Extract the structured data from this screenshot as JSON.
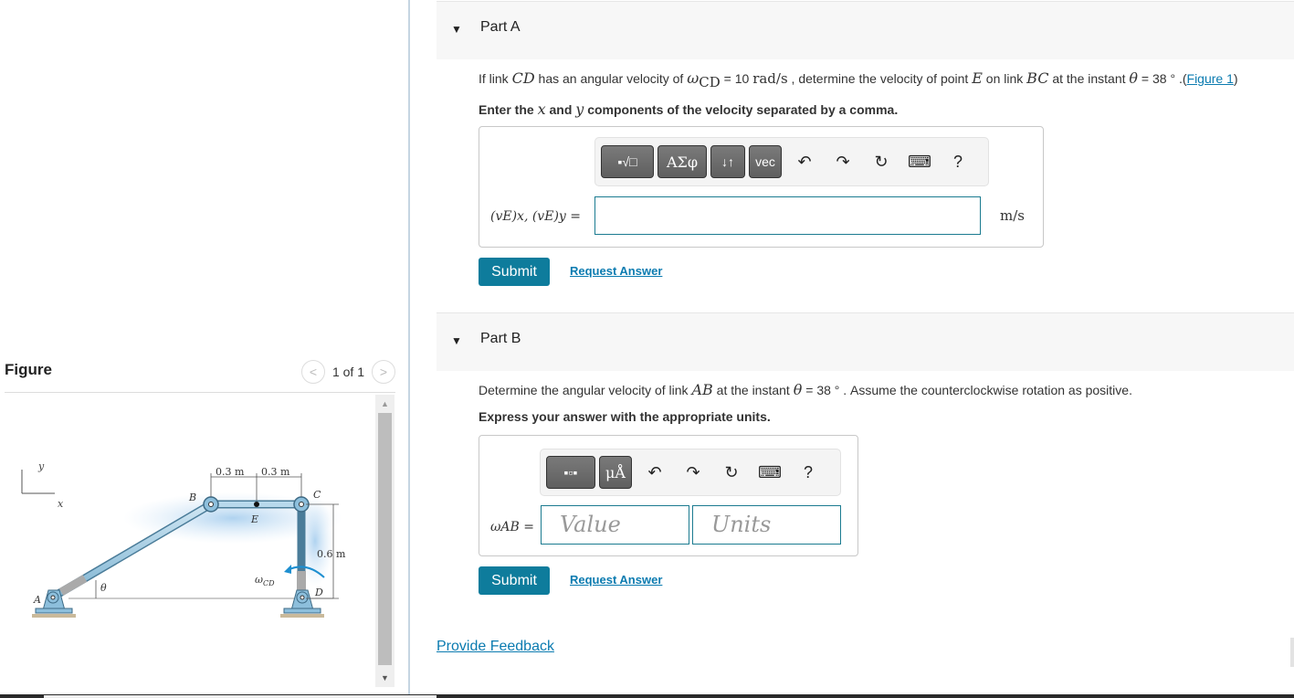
{
  "figure": {
    "title": "Figure",
    "counter": "1 of 1",
    "prev_glyph": "<",
    "next_glyph": ">",
    "diagram": {
      "axis_y": "y",
      "axis_x": "x",
      "labels": {
        "A": "A",
        "B": "B",
        "C": "C",
        "D": "D",
        "E": "E",
        "theta": "θ",
        "omega_cd": "ω",
        "omega_sub": "CD"
      },
      "dims": {
        "be": "0.3 m",
        "ec": "0.3 m",
        "cd": "0.6 m"
      }
    },
    "scroll_up": "▲",
    "scroll_down": "▼"
  },
  "partA": {
    "caret": "▼",
    "title": "Part A",
    "question": {
      "t1": "If link ",
      "cd": "CD",
      "t2": " has an angular velocity of ",
      "omega": "ω",
      "omega_sub": "CD",
      "t3": " = 10 ",
      "unit": "rad/s",
      "t4": " , determine the velocity of point ",
      "e": "E",
      "t5": " on link ",
      "bc": "BC",
      "t6": " at the instant ",
      "theta": "θ",
      "t7": " = 38 ° .(",
      "fig_link": "Figure 1",
      "t8": ")"
    },
    "instruction": {
      "t1": "Enter the ",
      "x": "x",
      "t2": " and ",
      "y": "y",
      "t3": " components of the velocity separated by a comma."
    },
    "toolbar": {
      "templates": "▪√□",
      "greek": "ΑΣφ",
      "arrows": "↓↑",
      "vec": "vec",
      "undo": "↶",
      "redo": "↷",
      "reset": "↻",
      "keyboard": "⌨",
      "help": "?"
    },
    "answer_label": "(vE)x, (vE)y =",
    "answer_value": "",
    "unit": "m/s",
    "submit": "Submit",
    "request": "Request Answer"
  },
  "partB": {
    "caret": "▼",
    "title": "Part B",
    "question": {
      "t1": "Determine the angular velocity of link ",
      "ab": "AB",
      "t2": " at the instant ",
      "theta": "θ",
      "t3": " = 38 ° . Assume the counterclockwise rotation as positive."
    },
    "instruction": "Express your answer with the appropriate units.",
    "toolbar": {
      "templates": "▪▫▪",
      "units": "μÅ",
      "undo": "↶",
      "redo": "↷",
      "reset": "↻",
      "keyboard": "⌨",
      "help": "?"
    },
    "answer_label": "ωAB =",
    "value_placeholder": "Value",
    "units_placeholder": "Units",
    "submit": "Submit",
    "request": "Request Answer"
  },
  "feedback": "Provide Feedback"
}
